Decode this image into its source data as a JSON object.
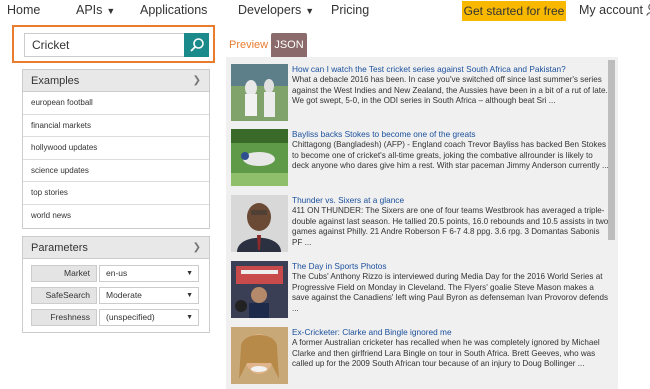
{
  "nav": {
    "home": "Home",
    "apis": "APIs",
    "applications": "Applications",
    "developers": "Developers",
    "pricing": "Pricing",
    "cta": "Get started for free",
    "account": "My account"
  },
  "search": {
    "value": "Cricket"
  },
  "examples": {
    "title": "Examples",
    "items": [
      "european football",
      "financial markets",
      "hollywood updates",
      "science updates",
      "top stories",
      "world news"
    ]
  },
  "parameters": {
    "title": "Parameters",
    "rows": [
      {
        "label": "Market",
        "value": "en-us"
      },
      {
        "label": "SafeSearch",
        "value": "Moderate"
      },
      {
        "label": "Freshness",
        "value": "(unspecified)"
      }
    ]
  },
  "tabs": {
    "preview": "Preview",
    "json": "JSON"
  },
  "results": [
    {
      "title": "How can I watch the Test cricket series against South Africa and Pakistan?",
      "desc": "What a debacle 2016 has been. In case you've switched off since last summer's series against the West Indies and New Zealand, the Aussies have been in a bit of a rut of late. We got swept, 5-0, in the ODI series in South Africa – although beat Sri ..."
    },
    {
      "title": "Bayliss backs Stokes to become one of the greats",
      "desc": "Chittagong (Bangladesh) (AFP) - England coach Trevor Bayliss has backed Ben Stokes to become one of cricket's all-time greats, joking the combative allrounder is likely to deck anyone who dares give him a rest. With star paceman Jimmy Anderson currently ..."
    },
    {
      "title": "Thunder vs. Sixers at a glance",
      "desc": "411 ON THUNDER: The Sixers are one of four teams Westbrook has averaged a triple-double against last season. He tallied 20.5 points, 16.0 rebounds and 10.5 assists in two games against Philly. 21 Andre Roberson F 6-7 4.8 ppg. 3.6 rpg. 3 Domantas Sabonis PF ..."
    },
    {
      "title": "The Day in Sports Photos",
      "desc": "The Cubs' Anthony Rizzo is interviewed during Media Day for the 2016 World Series at Progressive Field on Monday in Cleveland. The Flyers' goalie Steve Mason makes a save against the Canadiens' left wing Paul Byron as defenseman Ivan Provorov defends ..."
    },
    {
      "title": "Ex-Cricketer: Clarke and Bingle ignored me",
      "desc": "A former Australian cricketer has recalled when he was completely ignored by Michael Clarke and then girlfriend Lara Bingle on tour in South Africa. Brett Geeves, who was called up for the 2009 South African tour because of an injury to Doug Bollinger ..."
    }
  ],
  "colors": {
    "accent": "#e87d30",
    "cta": "#f8b800",
    "search_button": "#1a8a8a",
    "link": "#1a4f9c",
    "json_tab": "#8a6a6a"
  },
  "icons": {
    "search": "search-icon",
    "account": "person-icon",
    "chevron": "chevron-down-icon"
  }
}
